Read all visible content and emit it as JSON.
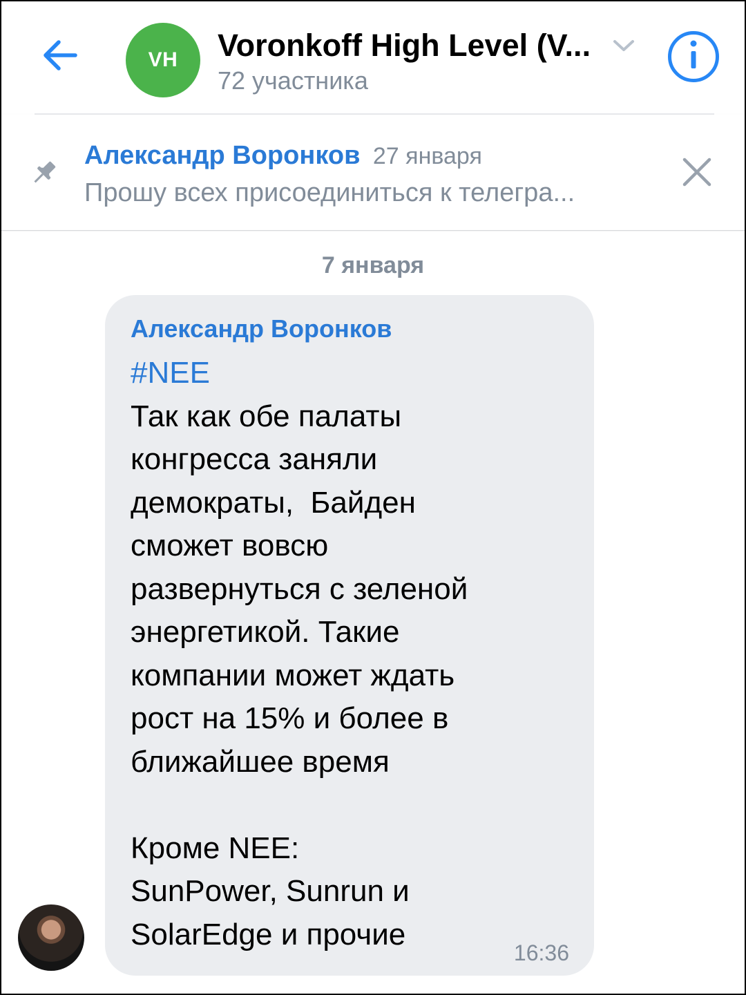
{
  "header": {
    "avatar_initials": "VH",
    "title": "Voronkoff High Level (V...",
    "subtitle": "72 участника",
    "accent_color": "#2787f5",
    "avatar_color": "#4bb34b",
    "icons": {
      "back": "arrow-left-icon",
      "expand": "chevron-down-icon",
      "info": "info-icon"
    }
  },
  "pinned": {
    "author": "Александр Воронков",
    "date": "27 января",
    "text": "Прошу всех присоединиться к телегра...",
    "icons": {
      "pin": "pin-icon",
      "close": "close-icon"
    }
  },
  "feed": {
    "date_separator": "7 января",
    "messages": [
      {
        "author": "Александр Воронков",
        "hashtag": "#NEE",
        "text": "Так как обе палаты\nконгресса заняли\nдемократы,  Байден\nсможет вовсю\nразвернуться с зеленой\nэнергетикой. Такие\nкомпании может ждать\nрост на 15% и более в\nближайшее время\n\nКроме NEE:\nSunPower, Sunrun и\nSolarEdge и прочие",
        "time": "16:36"
      }
    ]
  }
}
